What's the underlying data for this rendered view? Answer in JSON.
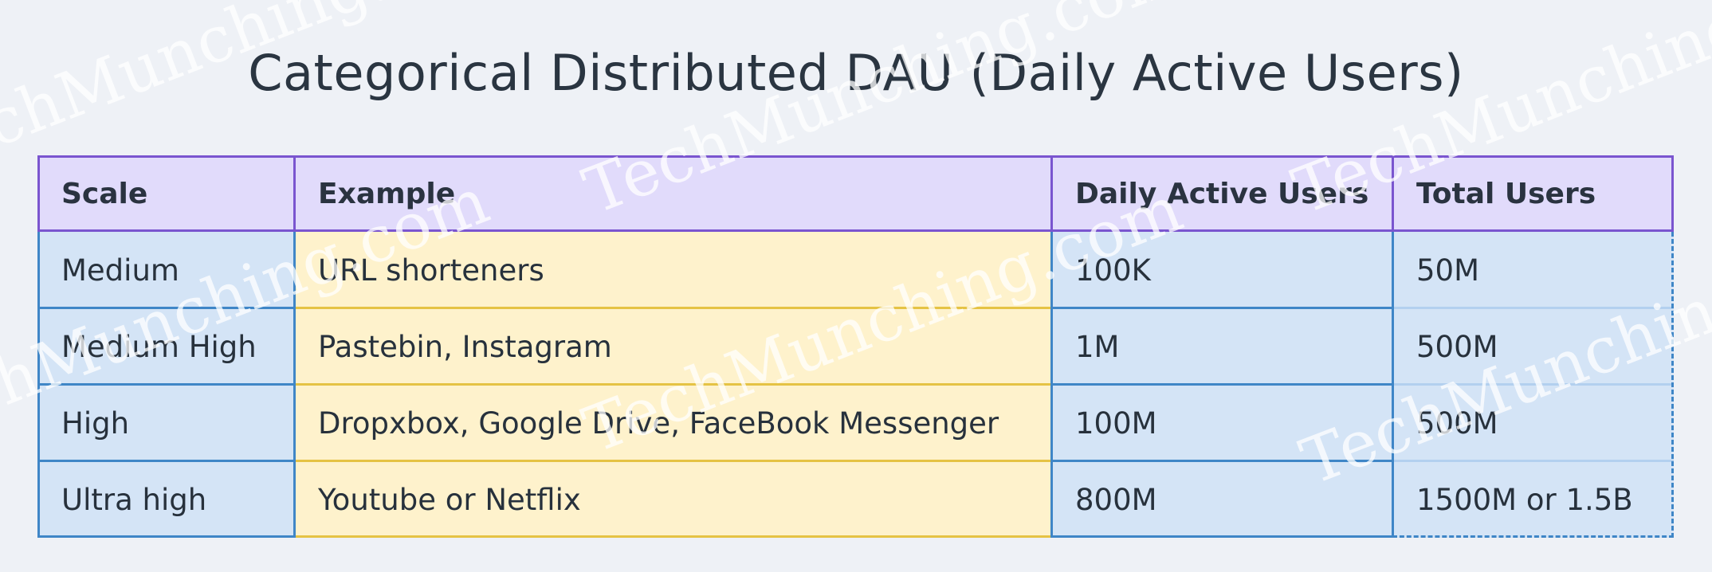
{
  "title": "Categorical Distributed DAU (Daily Active Users)",
  "watermark_text": "TechMunching.com",
  "table": {
    "headers": [
      "Scale",
      "Example",
      "Daily Active Users",
      "Total Users"
    ],
    "rows": [
      [
        "Medium",
        "URL shorteners",
        "100K",
        "50M"
      ],
      [
        "Medium High",
        "Pastebin, Instagram",
        "1M",
        "500M"
      ],
      [
        "High",
        "Dropxbox, Google Drive, FaceBook Messenger",
        "100M",
        "500M"
      ],
      [
        "Ultra high",
        "Youtube or Netflix",
        "800M",
        "1500M or 1.5B"
      ]
    ]
  },
  "colors": {
    "background": "#eef1f6",
    "header_fill": "#e1dbfb",
    "header_border": "#7a55cf",
    "blue_fill": "#d4e4f6",
    "blue_border": "#3f86c7",
    "yellow_fill": "#fef2cc",
    "yellow_border": "#e5c344"
  }
}
